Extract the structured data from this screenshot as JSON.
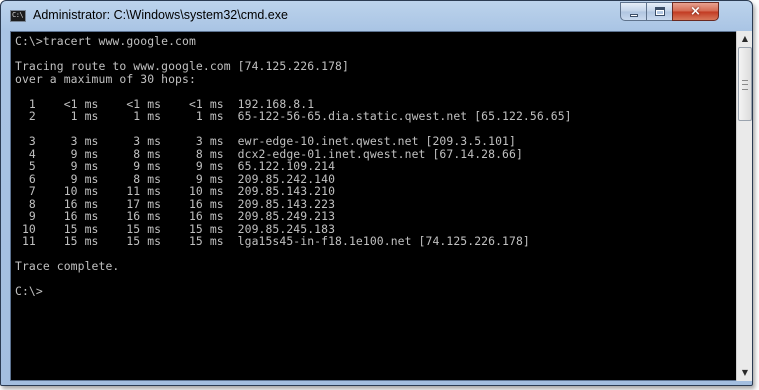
{
  "window": {
    "title": "Administrator: C:\\Windows\\system32\\cmd.exe",
    "icon": "cmd-icon",
    "icon_text": "C:\\",
    "controls": {
      "minimize": "minimize-icon",
      "maximize": "maximize-icon",
      "close": "×"
    }
  },
  "console": {
    "lines": [
      "C:\\>tracert www.google.com",
      "",
      "Tracing route to www.google.com [74.125.226.178]",
      "over a maximum of 30 hops:",
      "",
      "  1    <1 ms    <1 ms    <1 ms  192.168.8.1",
      "  2     1 ms     1 ms     1 ms  65-122-56-65.dia.static.qwest.net [65.122.56.65]",
      "",
      "  3     3 ms     3 ms     3 ms  ewr-edge-10.inet.qwest.net [209.3.5.101]",
      "  4     9 ms     8 ms     8 ms  dcx2-edge-01.inet.qwest.net [67.14.28.66]",
      "  5     9 ms     9 ms     9 ms  65.122.109.214",
      "  6     9 ms     8 ms     9 ms  209.85.242.140",
      "  7    10 ms    11 ms    10 ms  209.85.143.210",
      "  8    16 ms    17 ms    16 ms  209.85.143.223",
      "  9    16 ms    16 ms    16 ms  209.85.249.213",
      " 10    15 ms    15 ms    15 ms  209.85.245.183",
      " 11    15 ms    15 ms    15 ms  lga15s45-in-f18.1e100.net [74.125.226.178]",
      "",
      "Trace complete.",
      "",
      "C:\\>"
    ]
  },
  "scrollbar": {
    "up_arrow": "▲",
    "down_arrow": "▼"
  }
}
